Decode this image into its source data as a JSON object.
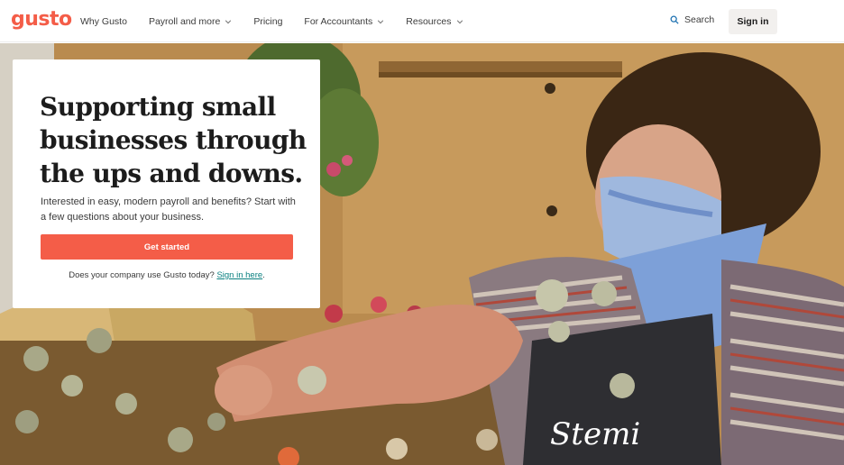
{
  "header": {
    "logo": "gusto",
    "nav": [
      {
        "label": "Why Gusto",
        "dropdown": false
      },
      {
        "label": "Payroll and more",
        "dropdown": true
      },
      {
        "label": "Pricing",
        "dropdown": false
      },
      {
        "label": "For Accountants",
        "dropdown": true
      },
      {
        "label": "Resources",
        "dropdown": true
      }
    ],
    "search_label": "Search",
    "signin_label": "Sign in"
  },
  "hero": {
    "headline": "Supporting small businesses through the ups and downs.",
    "subtext": "Interested in easy, modern payroll and benefits? Start with a few questions about your business.",
    "cta_label": "Get started",
    "existing_prefix": "Does your company use Gusto today?",
    "existing_link": "Sign in here",
    "existing_suffix": ".",
    "image_alt_icon": "florist-photo"
  },
  "colors": {
    "brand": "#f45d48",
    "link": "#0a8080"
  }
}
